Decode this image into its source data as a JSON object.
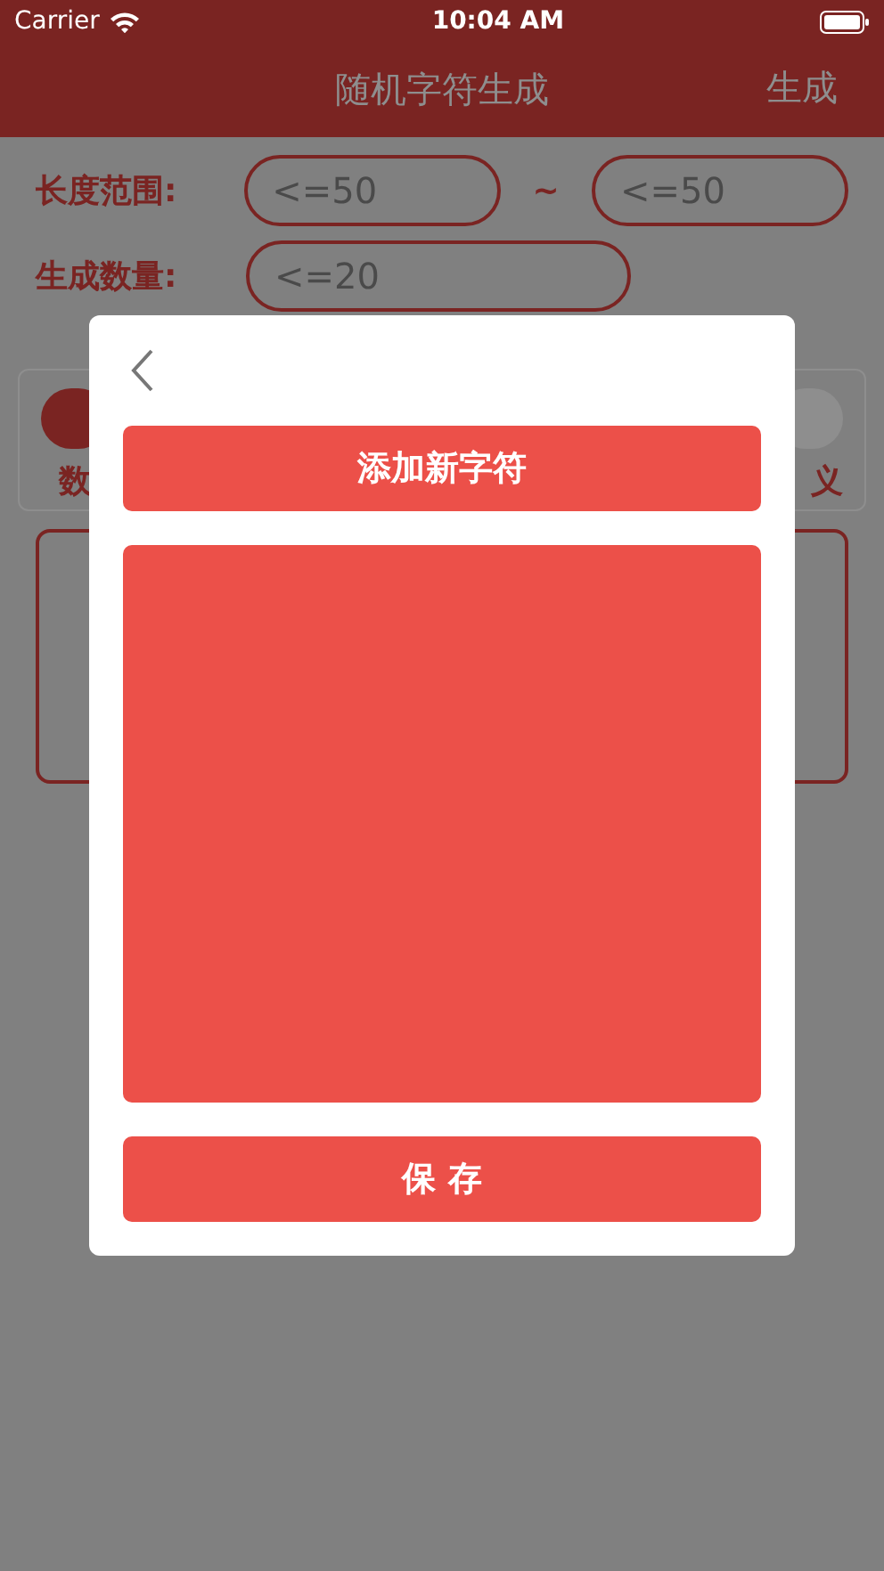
{
  "status_bar": {
    "carrier": "Carrier",
    "time": "10:04 AM"
  },
  "nav": {
    "title": "随机字符生成",
    "action": "生成"
  },
  "length_range": {
    "label": "长度范围:",
    "min": {
      "placeholder": "<=50"
    },
    "separator": "~",
    "max": {
      "placeholder": "<=50"
    }
  },
  "count": {
    "label": "生成数量:",
    "placeholder": "<=20"
  },
  "char_types": [
    {
      "label": "数",
      "selected": true
    },
    {
      "label": "义",
      "selected": false
    }
  ],
  "dialog": {
    "add_button": "添加新字符",
    "save_button": "保 存"
  }
}
